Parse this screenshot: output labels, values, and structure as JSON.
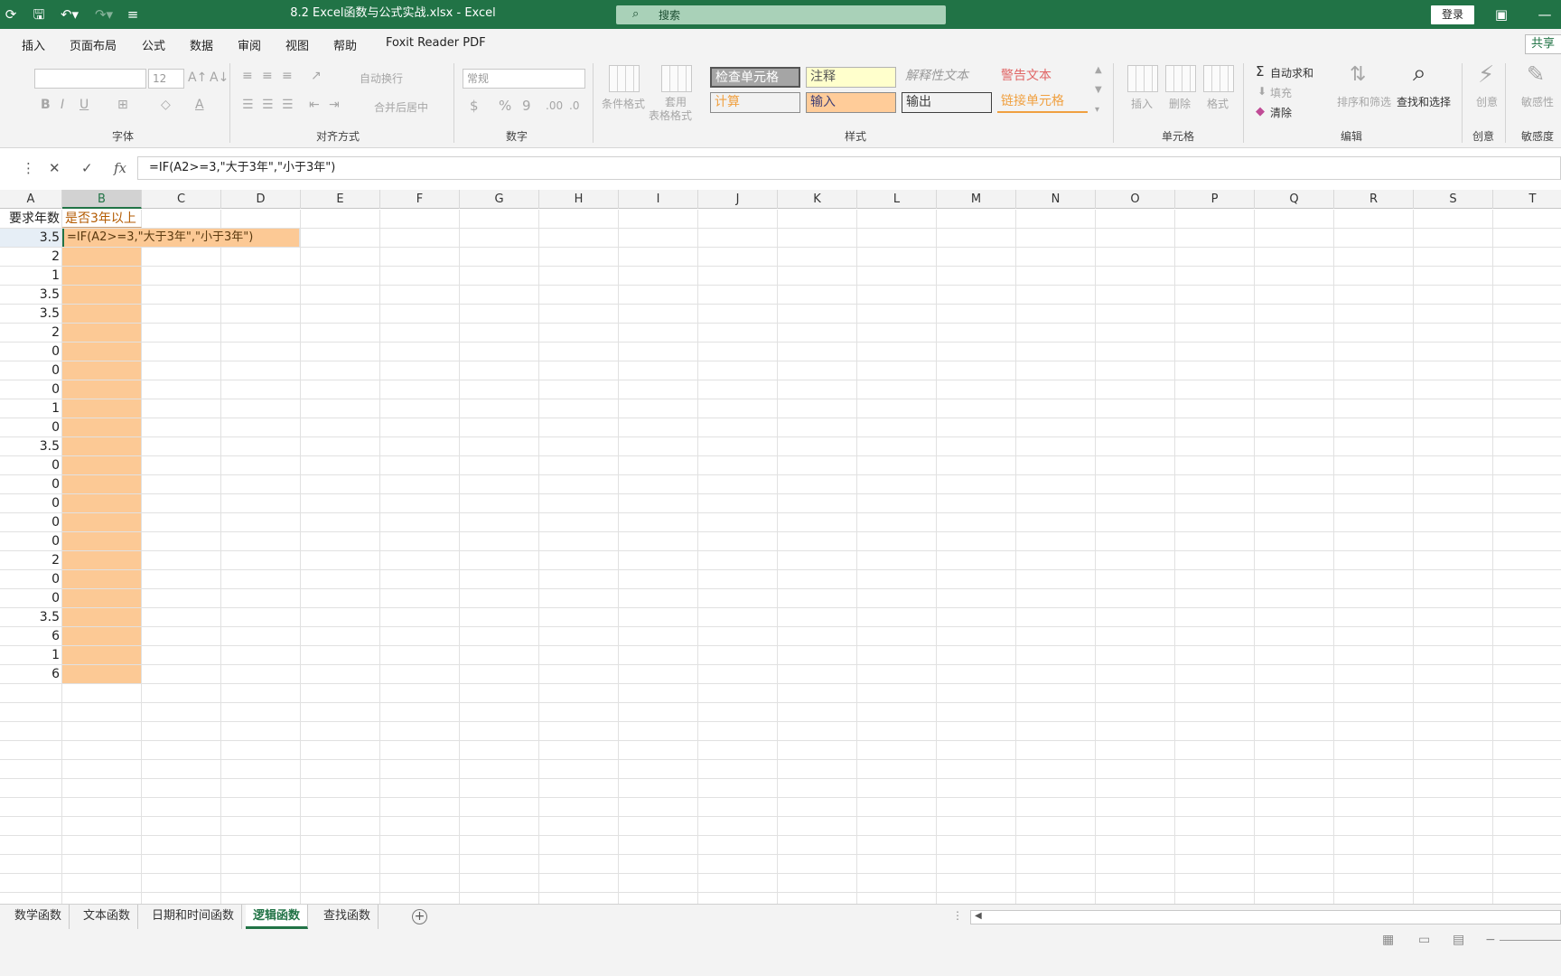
{
  "app": {
    "title": "8.2 Excel函数与公式实战.xlsx  -  Excel",
    "search_placeholder": "搜索",
    "login_label": "登录",
    "share_label": "共享"
  },
  "ribbon_tabs": [
    "插入",
    "页面布局",
    "公式",
    "数据",
    "审阅",
    "视图",
    "帮助",
    "Foxit Reader PDF"
  ],
  "ribbon": {
    "font_group": "字体",
    "font_size": "12",
    "align_group": "对齐方式",
    "wrap_text": "自动换行",
    "merge_center": "合并后居中",
    "number_group": "数字",
    "number_format": "常规",
    "styles_group": "样式",
    "cond_format": "条件格式",
    "table_format_1": "套用",
    "table_format_2": "表格格式",
    "style_cells": [
      "检查单元格",
      "注释",
      "解释性文本",
      "警告文本",
      "计算",
      "输入",
      "输出",
      "链接单元格"
    ],
    "cells_group": "单元格",
    "insert": "插入",
    "delete": "删除",
    "format": "格式",
    "editing_group": "编辑",
    "autosum": "自动求和",
    "fill": "填充",
    "clear": "清除",
    "sort_filter": "排序和筛选",
    "find_select": "查找和选择",
    "creative_group": "创意",
    "creative_btn": "创意",
    "sensitivity_group": "敏感度",
    "sensitivity_btn": "敏感性"
  },
  "formula_bar": {
    "fx": "fx",
    "formula": "=IF(A2>=3,\"大于3年\",\"小于3年\")"
  },
  "columns": [
    "A",
    "B",
    "C",
    "D",
    "E",
    "F",
    "G",
    "H",
    "I",
    "J",
    "K",
    "L",
    "M",
    "N",
    "O",
    "P",
    "Q",
    "R",
    "S",
    "T"
  ],
  "sheet": {
    "header_a": "要求年数",
    "header_b": "是否3年以上",
    "editing_cell_text": "=IF(A2>=3,\"大于3年\",\"小于3年\")",
    "values": [
      "3.5",
      "2",
      "1",
      "3.5",
      "3.5",
      "2",
      "0",
      "0",
      "0",
      "1",
      "0",
      "3.5",
      "0",
      "0",
      "0",
      "0",
      "0",
      "2",
      "0",
      "0",
      "3.5",
      "6",
      "1",
      "6"
    ]
  },
  "sheet_tabs": [
    "数学函数",
    "文本函数",
    "日期和时间函数",
    "逻辑函数",
    "查找函数"
  ],
  "active_sheet": "逻辑函数",
  "colors": {
    "excel_green": "#217346",
    "fill_orange": "#fcc995"
  }
}
